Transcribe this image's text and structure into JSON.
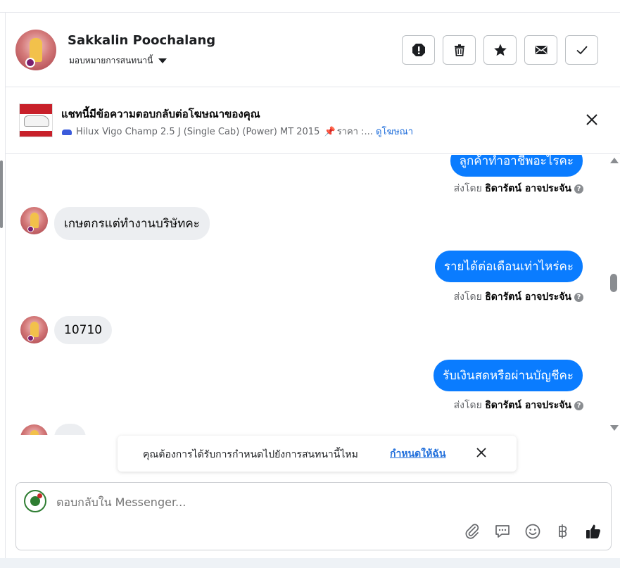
{
  "header": {
    "contact_name": "Sakkalin Poochalang",
    "assign_label": "มอบหมายการสนทนานี้",
    "actions": [
      {
        "name": "spam-button",
        "icon": "exclamation-icon"
      },
      {
        "name": "delete-button",
        "icon": "trash-icon"
      },
      {
        "name": "star-button",
        "icon": "star-icon"
      },
      {
        "name": "mark-unread-button",
        "icon": "envelope-icon"
      },
      {
        "name": "mark-done-button",
        "icon": "check-icon"
      }
    ]
  },
  "ad_banner": {
    "title": "แชทนี้มีข้อความตอบกลับต่อโฆษณาของคุณ",
    "product": "Hilux Vigo Champ 2.5 J (Single Cab) (Power) MT 2015",
    "price": "ราคา :...",
    "view_ad": "ดูโฆษณา"
  },
  "messages": [
    {
      "dir": "out",
      "text": "ลูกค้าทำอาชีพอะไรคะ"
    },
    {
      "dir": "in",
      "text": "เกษตกรแต่ทำงานบริษัทคะ"
    },
    {
      "dir": "out",
      "text": "รายได้ต่อเดือนเท่าไหร่คะ"
    },
    {
      "dir": "in",
      "text": "10710"
    },
    {
      "dir": "out",
      "text": "รับเงินสดหรือผ่านบัญชีคะ"
    },
    {
      "dir": "in",
      "text": "…"
    }
  ],
  "sent_by": {
    "prefix": "ส่งโดย",
    "agent": "ธิดารัตน์ อาจประจัน"
  },
  "toast": {
    "text": "คุณต้องการได้รับการกำหนดไปยังการสนทนานี้ไหม",
    "link": "กำหนดให้ฉัน"
  },
  "composer": {
    "placeholder": "ตอบกลับใน Messenger...",
    "tools": [
      "paperclip-icon",
      "chat-bubble-icon",
      "emoji-icon",
      "baht-icon",
      "thumbs-up-icon"
    ]
  },
  "colors": {
    "accent": "#0a7cff",
    "link": "#216fdb",
    "incoming_bubble": "#eceef1"
  }
}
